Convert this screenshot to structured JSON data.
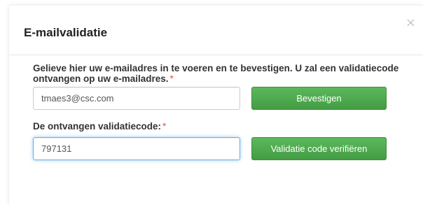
{
  "dialog": {
    "title": "E-mailvalidatie",
    "close_symbol": "×"
  },
  "email_section": {
    "instruction": "Gelieve hier uw e-mailadres in te voeren en te bevestigen. U zal een validatiecode ontvangen op uw e-mailadres.",
    "required_marker": "*",
    "email_value": "tmaes3@csc.com",
    "confirm_button": "Bevestigen"
  },
  "code_section": {
    "label": "De ontvangen validatiecode:",
    "required_marker": "*",
    "code_value": "797131",
    "verify_button": "Validatie code verifiëren"
  },
  "colors": {
    "button_green": "#5cb85c",
    "required_red": "#d9534f",
    "focus_blue": "#66afe9"
  }
}
